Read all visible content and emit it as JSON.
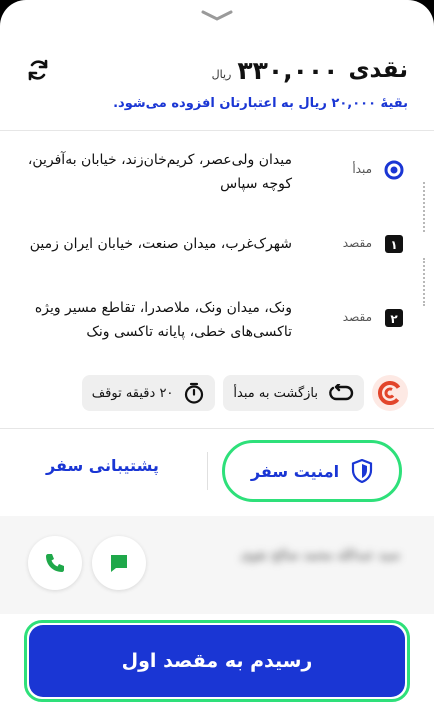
{
  "fare": {
    "label": "نقدی",
    "amount": "۳۳۰,۰۰۰",
    "currency": "ریال"
  },
  "credit_note": "بقیهٔ ۲۰,۰۰۰ ریال به اعتبارتان افزوده می‌شود.",
  "route": {
    "stops": [
      {
        "label": "مبدأ",
        "address": "میدان ولی‌عصر، کریم‌خان‌زند، خیابان به‌آفرین، کوچه سپاس"
      },
      {
        "label": "مقصد",
        "badge": "۱",
        "address": "شهرک‌غرب، میدان صنعت، خیابان ایران زمین"
      },
      {
        "label": "مقصد",
        "badge": "۲",
        "address": "ونک، میدان ونک، ملاصدرا، تقاطع مسیر ویژه تاکسی‌های خطی، پایانه تاکسی ونک"
      }
    ]
  },
  "chips": {
    "round_trip": "بازگشت به مبدأ",
    "wait": "۲۰ دقیقه توقف"
  },
  "actions": {
    "safety": "امنیت سفر",
    "support": "پشتیبانی سفر"
  },
  "driver": {
    "name": "سید عبدالله محمد صالح نقوی"
  },
  "cta": {
    "label": "رسیدم به مقصد اول"
  },
  "colors": {
    "primary": "#1a36d4",
    "highlight": "#2ee07a",
    "green": "#1fa84a",
    "brand_red": "#e2452b"
  }
}
